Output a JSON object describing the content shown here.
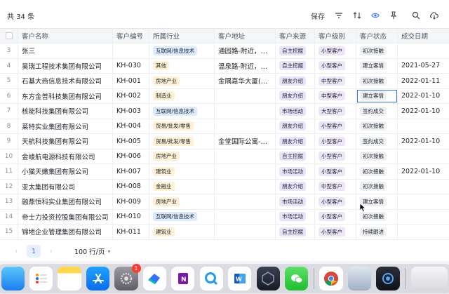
{
  "toolbar": {
    "record_count": "共 34 条",
    "save_label": "保存"
  },
  "table": {
    "columns": [
      "客户名称",
      "客户编号",
      "所属行业",
      "客户地址",
      "客户来源",
      "客户级别",
      "客户状态",
      "成交日期"
    ],
    "rows": [
      {
        "idx": "3",
        "name": "张三",
        "code": "",
        "industry": "互联网/信息技术",
        "address": "通园路-附近，江…",
        "source": "自主挖掘",
        "level": "小型客户",
        "status": "初次接触",
        "date": ""
      },
      {
        "idx": "4",
        "name": "昊瑞工程技术集团有限公司",
        "code": "KH-030",
        "industry": "其他",
        "address": "温泉路-附近，北…",
        "source": "自主挖掘",
        "level": "小型客户",
        "status": "建立客情",
        "date": "2021-05-27"
      },
      {
        "idx": "5",
        "name": "石基大商信息技术有限公司",
        "code": "KH-001",
        "industry": "房地产业",
        "address": "金隅嘉华大厦(B座…",
        "source": "朋友介绍",
        "level": "中型客户",
        "status": "初次接触",
        "date": "2022-01-11"
      },
      {
        "idx": "6",
        "name": "东方金普科技集团有限公司",
        "code": "KH-002",
        "industry": "制造业",
        "address": "",
        "source": "朋友介绍",
        "level": "中型客户",
        "status": "建立客情",
        "date": "2022-01-10"
      },
      {
        "idx": "7",
        "name": "核能科技集团有限公司",
        "code": "KH-003",
        "industry": "互联网/信息技术",
        "address": "",
        "source": "市场活动",
        "level": "大型客户",
        "status": "签约成交",
        "date": "2022-01-10"
      },
      {
        "idx": "8",
        "name": "莱特实业集团有限公司",
        "code": "KH-004",
        "industry": "贸易/批发/零售",
        "address": "",
        "source": "朋友介绍",
        "level": "小型客户",
        "status": "初次接触",
        "date": ""
      },
      {
        "idx": "9",
        "name": "天航科技集团有限公司",
        "code": "KH-005",
        "industry": "贸易/批发/零售",
        "address": "金堂国际公寓-附…",
        "source": "朋友介绍",
        "level": "小型客户",
        "status": "签约成交",
        "date": "2022-01-10"
      },
      {
        "idx": "10",
        "name": "金崚航电源科技有限公司",
        "code": "KH-006",
        "industry": "房地产业",
        "address": "",
        "source": "自主挖掘",
        "level": "小型客户",
        "status": "初次接触",
        "date": ""
      },
      {
        "idx": "11",
        "name": "小猫天嫩集团有限公司",
        "code": "KH-007",
        "industry": "建筑业",
        "address": "",
        "source": "市场活动",
        "level": "小型客户",
        "status": "初次接触",
        "date": "2022-01-10"
      },
      {
        "idx": "12",
        "name": "亚太集团有限公司",
        "code": "KH-008",
        "industry": "金融业",
        "address": "",
        "source": "朋友介绍",
        "level": "中型客户",
        "status": "初次接触",
        "date": ""
      },
      {
        "idx": "13",
        "name": "融鼎恒科实业集团有限公司",
        "code": "KH-009",
        "industry": "房地产业",
        "address": "",
        "source": "市场活动",
        "level": "小型客户",
        "status": "建立客情",
        "date": ""
      },
      {
        "idx": "14",
        "name": "帝士力投资控股集团有限公司",
        "code": "KH-010",
        "industry": "互联网/信息技术",
        "address": "",
        "source": "市场活动",
        "level": "小型客户",
        "status": "初次接触",
        "date": ""
      },
      {
        "idx": "15",
        "name": "锦地企业管理集团有限公司",
        "code": "KH-011",
        "industry": "建筑业",
        "address": "",
        "source": "自主挖掘",
        "level": "小型客户",
        "status": "持续跟进",
        "date": ""
      }
    ]
  },
  "pager": {
    "current_page": "1",
    "page_size": "100 行/页"
  },
  "dock": {
    "settings_badge": "1"
  },
  "colors": {
    "accent": "#3370ff",
    "tag_industry_bg": "#fff1d6",
    "tag_it_bg": "#dbeafe",
    "tag_source_bg": "#e8e3fb",
    "tag_level_bg": "#ede6f9",
    "tag_status_bg": "#eef0f3"
  }
}
